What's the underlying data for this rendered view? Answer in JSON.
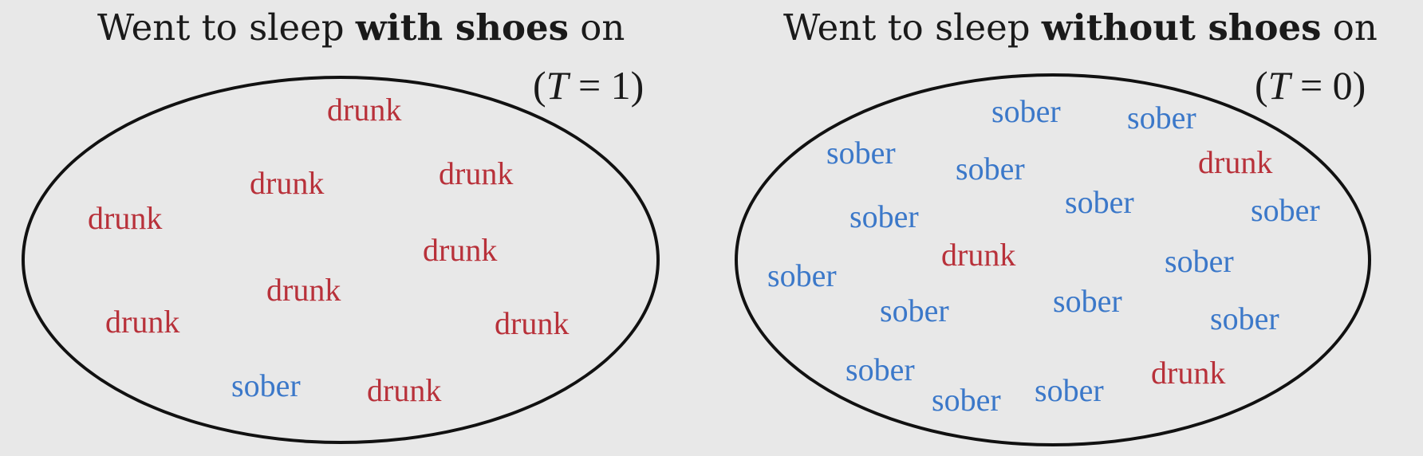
{
  "colors": {
    "background": "#e8e8e8",
    "drunk": "#b8313a",
    "sober": "#3b78c9",
    "outline": "#111111"
  },
  "left_panel": {
    "title_prefix": "Went to sleep ",
    "title_bold": "with shoes",
    "title_suffix": " on",
    "treatment_var": "T",
    "treatment_rest": " = 1",
    "words": [
      {
        "text": "drunk",
        "kind": "drunk"
      },
      {
        "text": "drunk",
        "kind": "drunk"
      },
      {
        "text": "drunk",
        "kind": "drunk"
      },
      {
        "text": "drunk",
        "kind": "drunk"
      },
      {
        "text": "drunk",
        "kind": "drunk"
      },
      {
        "text": "drunk",
        "kind": "drunk"
      },
      {
        "text": "drunk",
        "kind": "drunk"
      },
      {
        "text": "drunk",
        "kind": "drunk"
      },
      {
        "text": "sober",
        "kind": "sober"
      },
      {
        "text": "drunk",
        "kind": "drunk"
      }
    ]
  },
  "right_panel": {
    "title_prefix": "Went to sleep ",
    "title_bold": "without shoes",
    "title_suffix": " on",
    "treatment_var": "T",
    "treatment_rest": " = 0",
    "words": [
      {
        "text": "sober",
        "kind": "sober"
      },
      {
        "text": "sober",
        "kind": "sober"
      },
      {
        "text": "sober",
        "kind": "sober"
      },
      {
        "text": "sober",
        "kind": "sober"
      },
      {
        "text": "drunk",
        "kind": "drunk"
      },
      {
        "text": "sober",
        "kind": "sober"
      },
      {
        "text": "sober",
        "kind": "sober"
      },
      {
        "text": "sober",
        "kind": "sober"
      },
      {
        "text": "drunk",
        "kind": "drunk"
      },
      {
        "text": "sober",
        "kind": "sober"
      },
      {
        "text": "sober",
        "kind": "sober"
      },
      {
        "text": "sober",
        "kind": "sober"
      },
      {
        "text": "sober",
        "kind": "sober"
      },
      {
        "text": "sober",
        "kind": "sober"
      },
      {
        "text": "sober",
        "kind": "sober"
      },
      {
        "text": "sober",
        "kind": "sober"
      },
      {
        "text": "sober",
        "kind": "sober"
      },
      {
        "text": "drunk",
        "kind": "drunk"
      }
    ]
  }
}
